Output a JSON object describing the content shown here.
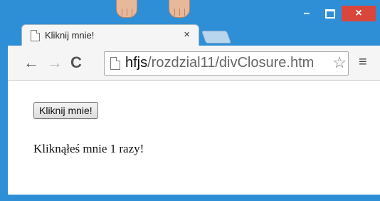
{
  "window": {
    "minimize_symbol": "–",
    "close_symbol": "×",
    "frame_color": "#2f8fd6",
    "close_color": "#d9473c"
  },
  "tab": {
    "title": "Kliknij mnie!",
    "close_symbol": "×"
  },
  "toolbar": {
    "back_symbol": "←",
    "forward_symbol": "→",
    "reload_symbol": "C",
    "url_host": "hfjs",
    "url_path": "/rozdzial11/divClosure.htm",
    "star_symbol": "☆",
    "menu_symbol": "≡"
  },
  "page": {
    "button_label": "Kliknij mnie!",
    "message": "Kliknąłeś mnie 1 razy!"
  }
}
